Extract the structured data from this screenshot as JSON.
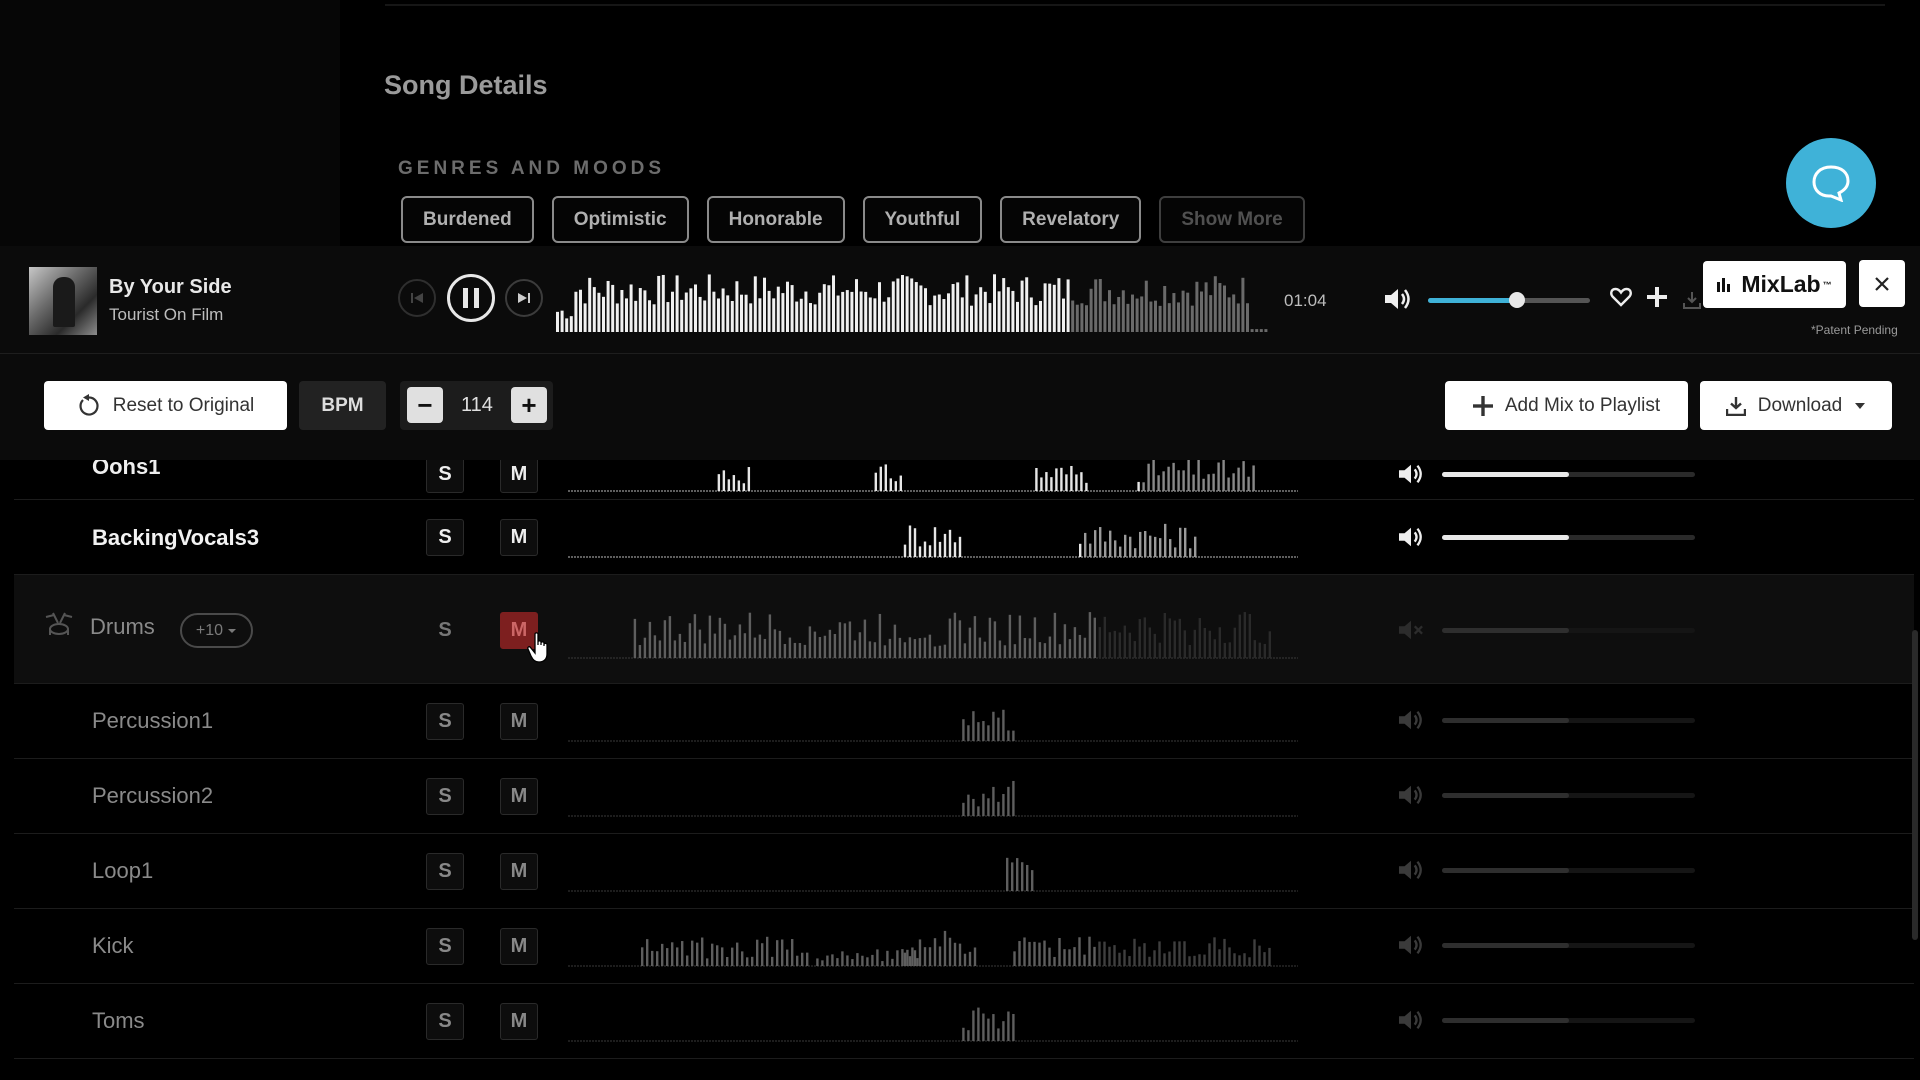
{
  "song_details": {
    "title": "Song Details",
    "genres_title": "GENRES AND MOODS",
    "genres": [
      "Burdened",
      "Optimistic",
      "Honorable",
      "Youthful",
      "Revelatory"
    ],
    "show_more": "Show More"
  },
  "player": {
    "track_title": "By Your Side",
    "artist": "Tourist On Film",
    "time": "01:04",
    "progress": 0.72,
    "volume": 0.55,
    "mixlab_label": "MixLab",
    "mixlab_tm": "™",
    "patent": "*Patent Pending"
  },
  "toolbar": {
    "reset_label": "Reset to Original",
    "bpm_label": "BPM",
    "bpm_minus": "−",
    "bpm_value": "114",
    "bpm_plus": "+",
    "add_mix_label": "Add Mix to Playlist",
    "download_label": "Download"
  },
  "tracks": [
    {
      "name": "Oohs1",
      "s": "S",
      "m": "M",
      "volume": 0.5,
      "muted": false,
      "active": true
    },
    {
      "name": "BackingVocals3",
      "s": "S",
      "m": "M",
      "volume": 0.5,
      "muted": false,
      "active": true
    },
    {
      "name": "Drums",
      "s": "S",
      "m": "M",
      "volume": 0.5,
      "muted": true,
      "active": false,
      "group_count": "+10"
    },
    {
      "name": "Percussion1",
      "s": "S",
      "m": "M",
      "volume": 0.5,
      "muted": true,
      "active": false
    },
    {
      "name": "Percussion2",
      "s": "S",
      "m": "M",
      "volume": 0.5,
      "muted": true,
      "active": false
    },
    {
      "name": "Loop1",
      "s": "S",
      "m": "M",
      "volume": 0.5,
      "muted": true,
      "active": false
    },
    {
      "name": "Kick",
      "s": "S",
      "m": "M",
      "volume": 0.5,
      "muted": true,
      "active": false
    },
    {
      "name": "Toms",
      "s": "S",
      "m": "M",
      "volume": 0.5,
      "muted": true,
      "active": false
    }
  ],
  "colors": {
    "accent": "#3fb2d8",
    "mute_active": "#7d1f1f"
  },
  "icons": {
    "chat": "chat-bubble-icon",
    "volume": "speaker-icon",
    "heart": "heart-icon",
    "plus": "plus-icon",
    "download": "download-icon",
    "reset": "refresh-icon",
    "close": "close-icon",
    "drums": "drum-kit-icon"
  }
}
